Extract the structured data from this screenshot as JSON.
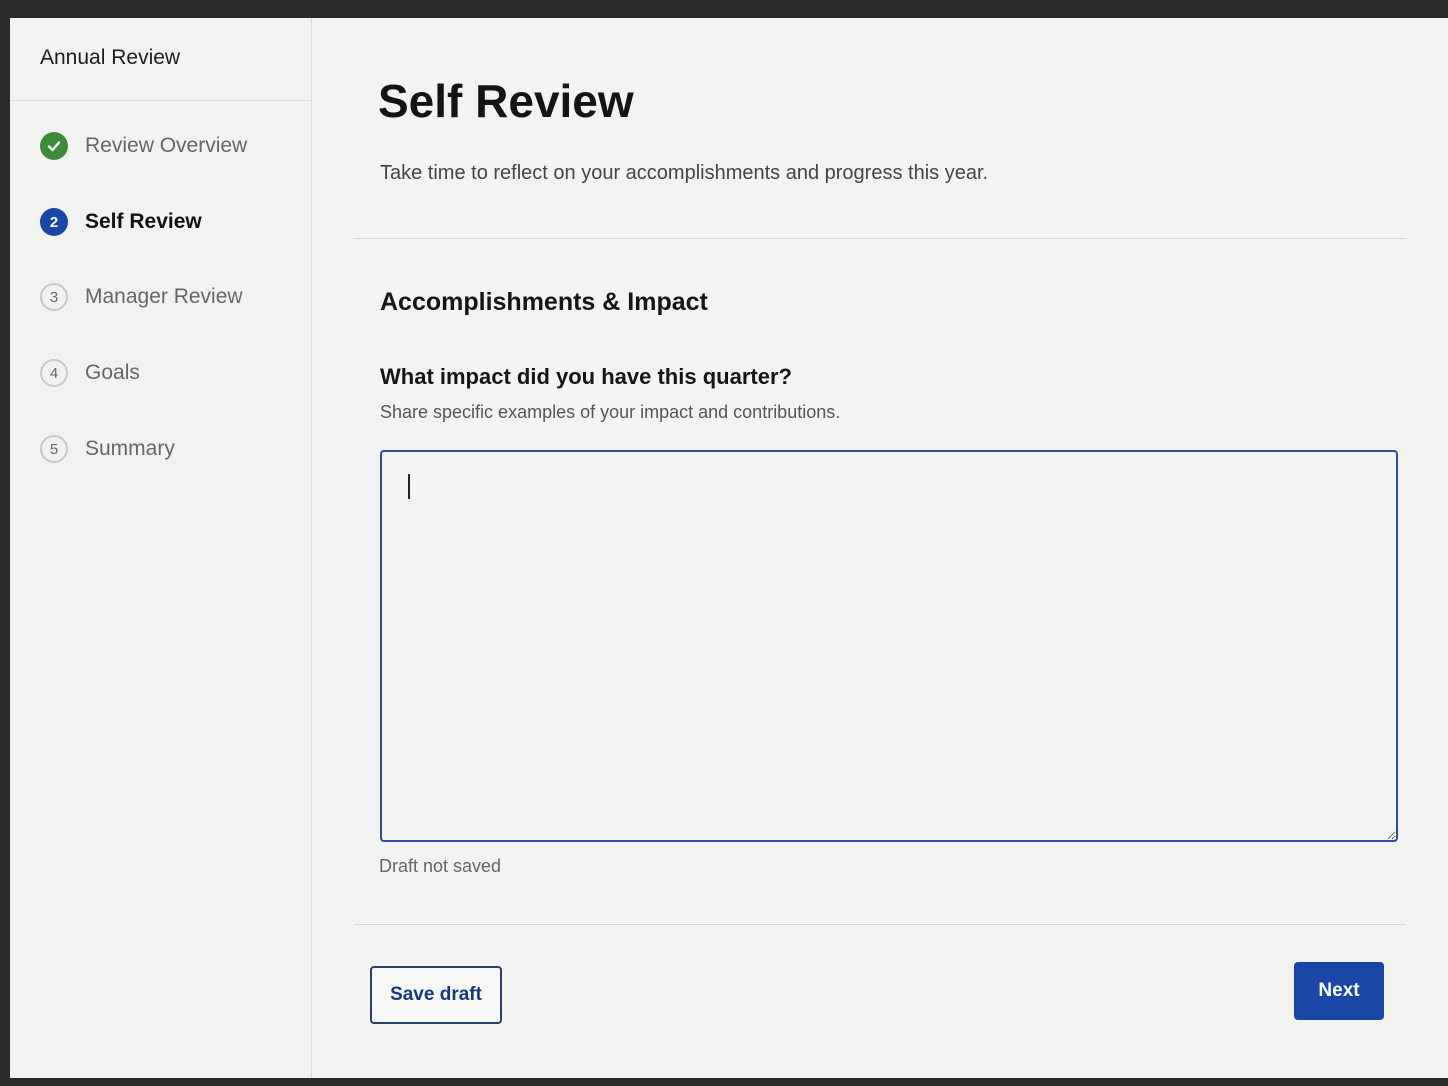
{
  "sidebar": {
    "title": "Annual Review",
    "steps": [
      {
        "number": "",
        "label": "Review Overview",
        "state": "complete"
      },
      {
        "number": "2",
        "label": "Self Review",
        "state": "current"
      },
      {
        "number": "3",
        "label": "Manager Review",
        "state": "upcoming"
      },
      {
        "number": "4",
        "label": "Goals",
        "state": "upcoming"
      },
      {
        "number": "5",
        "label": "Summary",
        "state": "upcoming"
      }
    ]
  },
  "main": {
    "title": "Self Review",
    "subtitle": "Take time to reflect on your accomplishments and progress this year.",
    "section": {
      "title": "Accomplishments & Impact",
      "question": {
        "label": "What impact did you have this quarter?",
        "hint": "Share specific examples of your impact and contributions.",
        "value": ""
      }
    },
    "draft_status": "Draft not saved",
    "buttons": {
      "save_draft": "Save draft",
      "next": "Next"
    }
  },
  "colors": {
    "accent": "#1a46a8",
    "complete": "#3d8a3a",
    "input_border": "#2c4f9c"
  },
  "icons": {
    "complete_step": "check-icon"
  }
}
